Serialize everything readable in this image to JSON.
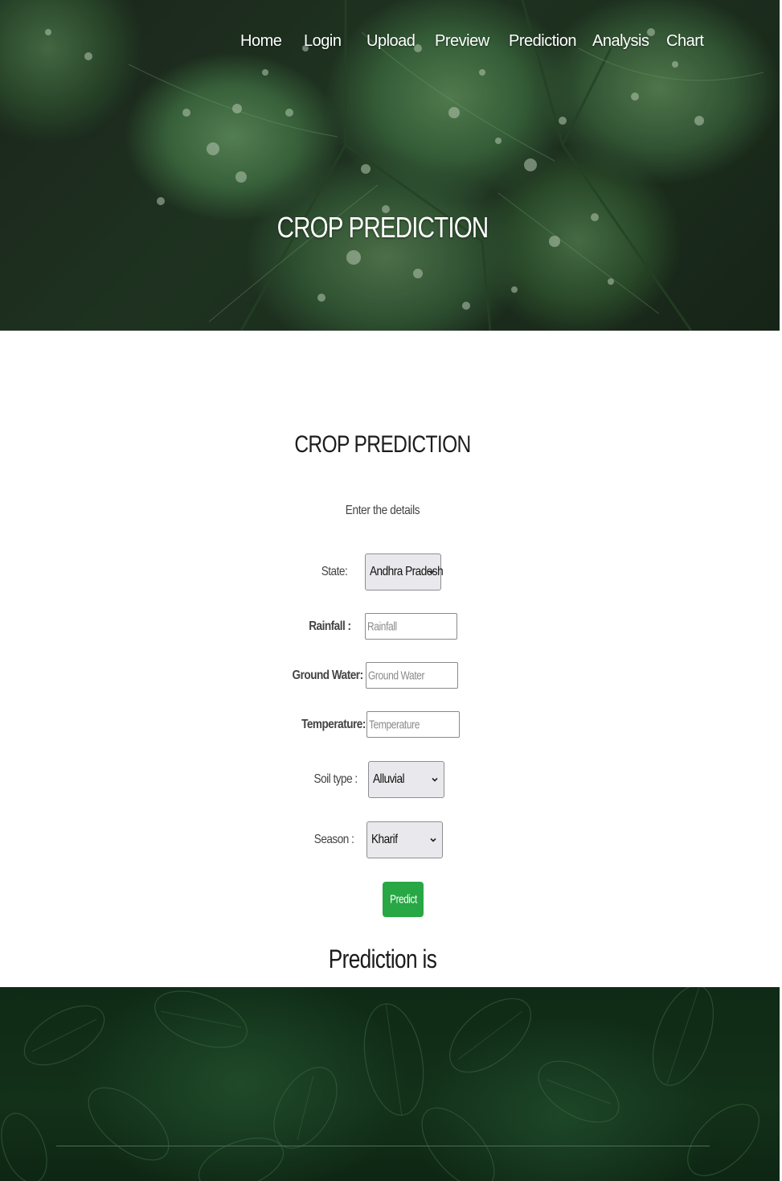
{
  "nav": {
    "items": [
      {
        "label": "Home"
      },
      {
        "label": "Login"
      },
      {
        "label": "Upload"
      },
      {
        "label": "Preview"
      },
      {
        "label": "Prediction"
      },
      {
        "label": "Analysis"
      },
      {
        "label": "Chart"
      }
    ]
  },
  "hero": {
    "title": "CROP PREDICTION"
  },
  "form": {
    "title": "CROP PREDICTION",
    "subtitle": "Enter the details",
    "state": {
      "label": "State:",
      "value": "Andhra Pradesh"
    },
    "rainfall": {
      "label": "Rainfall :",
      "placeholder": "Rainfall"
    },
    "ground_water": {
      "label": "Ground Water:",
      "placeholder": "Ground Water"
    },
    "temperature": {
      "label": "Temperature:",
      "placeholder": "Temperature"
    },
    "soil_type": {
      "label": "Soil type :",
      "value": "Alluvial"
    },
    "season": {
      "label": "Season :",
      "value": "Kharif"
    },
    "predict_label": "Predict"
  },
  "result": {
    "text": "Prediction is"
  },
  "colors": {
    "accent_button": "#28a745",
    "footer_bg": "#0f2a16"
  }
}
